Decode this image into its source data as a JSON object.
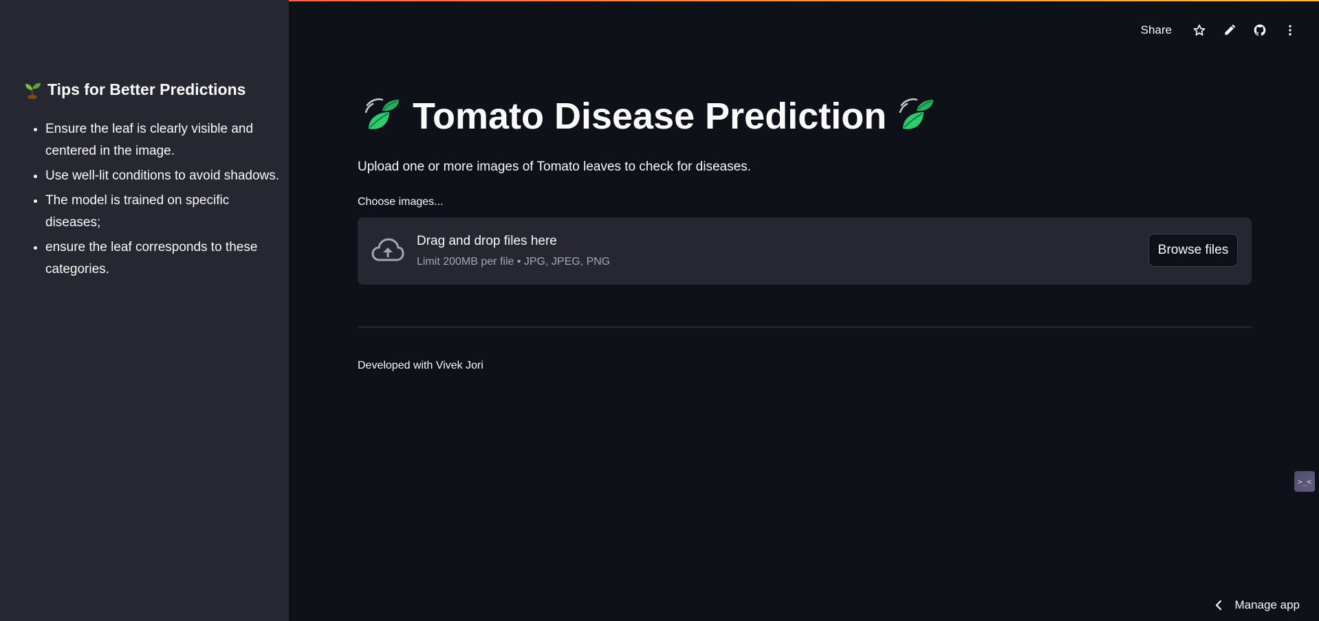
{
  "colors": {
    "background": "#0e1117",
    "sidebar": "#262730",
    "text": "#fafafa",
    "muted": "#a3a8b8",
    "accent_top": "#ff4b4b",
    "leaf_green": "#2ecc71"
  },
  "sidebar": {
    "title": "Tips for Better Predictions",
    "title_icon": "seedling-icon",
    "tips": [
      "Ensure the leaf is clearly visible and centered in the image.",
      "Use well-lit conditions to avoid shadows.",
      "The model is trained on specific diseases;",
      "ensure the leaf corresponds to these categories."
    ]
  },
  "toolbar": {
    "share_label": "Share",
    "icons": [
      "star-icon",
      "pencil-icon",
      "github-icon",
      "more-vert-icon"
    ]
  },
  "main": {
    "title": "Tomato Disease Prediction",
    "title_icon": "leaf-fluttering-icon",
    "subtitle": "Upload one or more images of Tomato leaves to check for diseases.",
    "uploader": {
      "label": "Choose images...",
      "drop_title": "Drag and drop files here",
      "limit_text": "Limit 200MB per file • JPG, JPEG, PNG",
      "browse_label": "Browse files"
    },
    "footer": "Developed with Vivek Jori"
  },
  "manage_app": {
    "label": "Manage app"
  }
}
